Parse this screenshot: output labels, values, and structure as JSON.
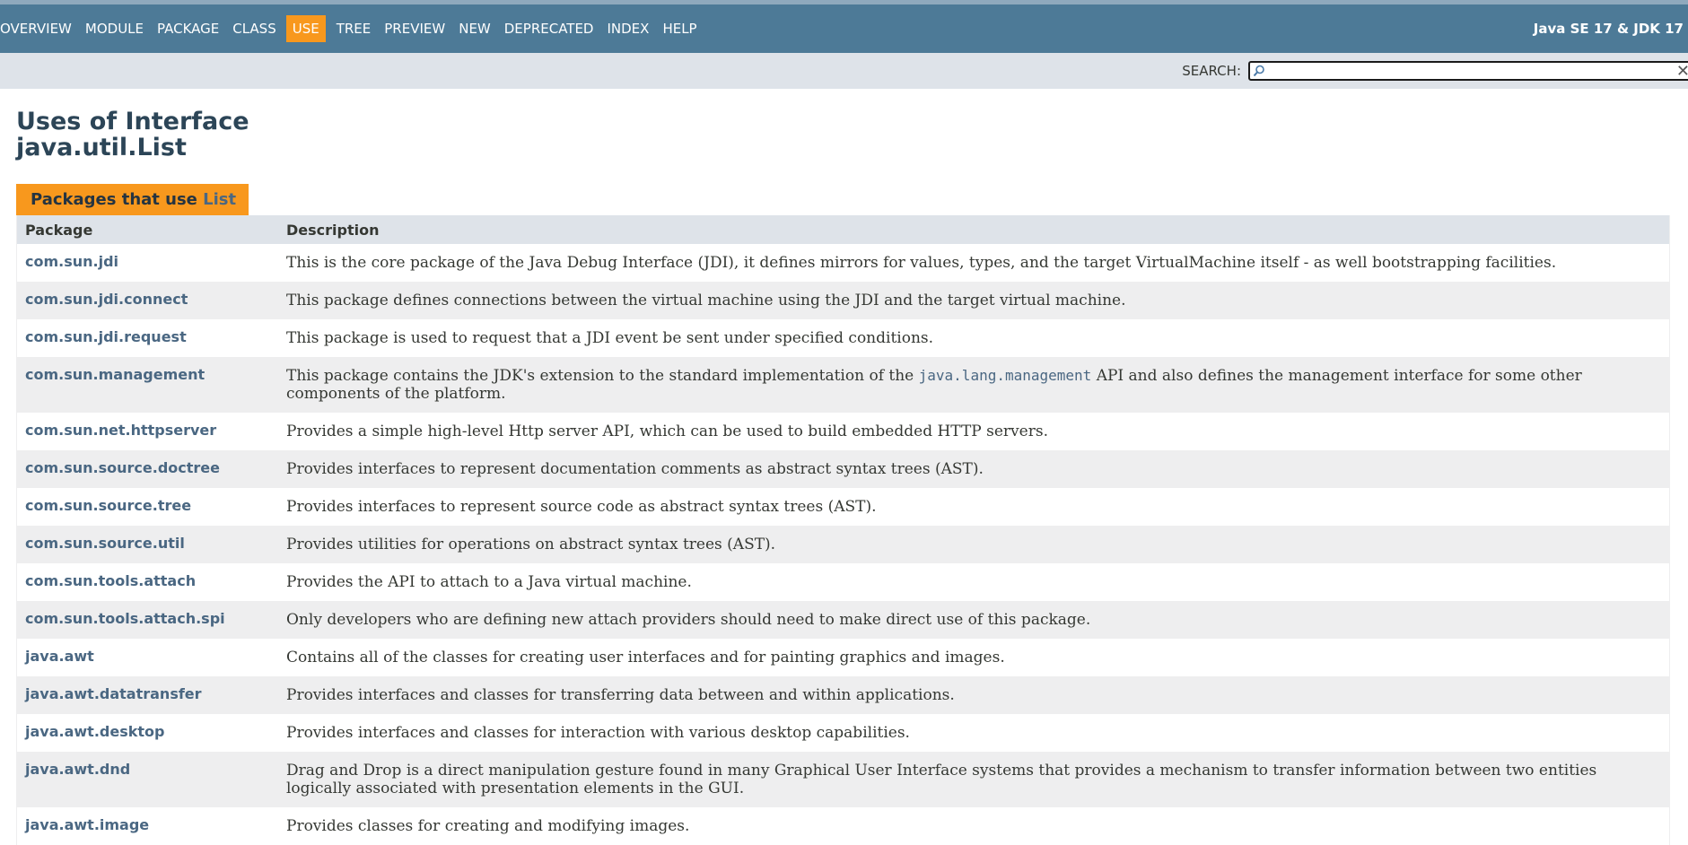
{
  "nav": {
    "items": [
      "OVERVIEW",
      "MODULE",
      "PACKAGE",
      "CLASS",
      "USE",
      "TREE",
      "PREVIEW",
      "NEW",
      "DEPRECATED",
      "INDEX",
      "HELP"
    ],
    "active": "USE",
    "about": "Java SE 17 & JDK 17"
  },
  "search": {
    "label": "SEARCH:",
    "value": ""
  },
  "page": {
    "title_line1": "Uses of Interface",
    "title_line2": "java.util.List"
  },
  "table": {
    "caption_prefix": "Packages that use ",
    "caption_link": "List",
    "headers": {
      "package": "Package",
      "description": "Description"
    },
    "rows": [
      {
        "package": "com.sun.jdi",
        "description": "This is the core package of the Java Debug Interface (JDI), it defines mirrors for values, types, and the target VirtualMachine itself - as well bootstrapping facilities."
      },
      {
        "package": "com.sun.jdi.connect",
        "description": "This package defines connections between the virtual machine using the JDI and the target virtual machine."
      },
      {
        "package": "com.sun.jdi.request",
        "description": "This package is used to request that a JDI event be sent under specified conditions."
      },
      {
        "package": "com.sun.management",
        "description_pre": "This package contains the JDK's extension to the standard implementation of the ",
        "description_code": "java.lang.management",
        "description_post": " API and also defines the management interface for some other components of the platform."
      },
      {
        "package": "com.sun.net.httpserver",
        "description": "Provides a simple high-level Http server API, which can be used to build embedded HTTP servers."
      },
      {
        "package": "com.sun.source.doctree",
        "description": "Provides interfaces to represent documentation comments as abstract syntax trees (AST)."
      },
      {
        "package": "com.sun.source.tree",
        "description": "Provides interfaces to represent source code as abstract syntax trees (AST)."
      },
      {
        "package": "com.sun.source.util",
        "description": "Provides utilities for operations on abstract syntax trees (AST)."
      },
      {
        "package": "com.sun.tools.attach",
        "description": "Provides the API to attach to a Java virtual machine."
      },
      {
        "package": "com.sun.tools.attach.spi",
        "description": "Only developers who are defining new attach providers should need to make direct use of this package."
      },
      {
        "package": "java.awt",
        "description": "Contains all of the classes for creating user interfaces and for painting graphics and images."
      },
      {
        "package": "java.awt.datatransfer",
        "description": "Provides interfaces and classes for transferring data between and within applications."
      },
      {
        "package": "java.awt.desktop",
        "description": "Provides interfaces and classes for interaction with various desktop capabilities."
      },
      {
        "package": "java.awt.dnd",
        "description": "Drag and Drop is a direct manipulation gesture found in many Graphical User Interface systems that provides a mechanism to transfer information between two entities logically associated with presentation elements in the GUI."
      },
      {
        "package": "java.awt.image",
        "description": "Provides classes for creating and modifying images."
      }
    ]
  },
  "colors": {
    "navbar": "#4d7a97",
    "active_tab": "#f8981d",
    "subnav": "#dee3e9",
    "link": "#4a6782",
    "row_alt": "#eeeeef"
  }
}
